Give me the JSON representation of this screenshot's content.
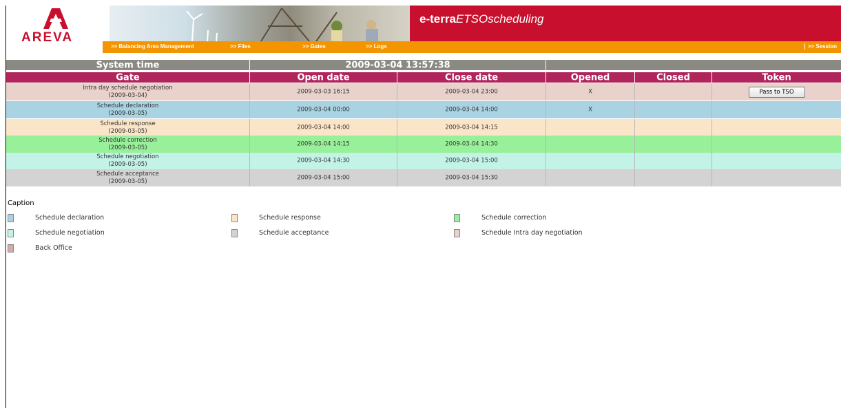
{
  "header": {
    "logo_text": "AREVA",
    "brand_prefix": "e-terra",
    "brand_suffix": "ETSOscheduling",
    "nav": {
      "balancing": ">> Balancing Area Management",
      "files": ">> Files",
      "gates": ">> Gates",
      "logs": ">> Logs",
      "session": ">> Session"
    }
  },
  "system": {
    "label": "System time",
    "value": "2009-03-04 13:57:38"
  },
  "table": {
    "columns": [
      "Gate",
      "Open date",
      "Close date",
      "Opened",
      "Closed",
      "Token"
    ],
    "rows": [
      {
        "gate": "Intra day schedule negotiation",
        "gate_date": "(2009-03-04)",
        "open": "2009-03-03 16:15",
        "close": "2009-03-04 23:00",
        "opened": "X",
        "closed": "",
        "token": "Pass to TSO"
      },
      {
        "gate": "Schedule declaration",
        "gate_date": "(2009-03-05)",
        "open": "2009-03-04 00:00",
        "close": "2009-03-04 14:00",
        "opened": "X",
        "closed": "",
        "token": ""
      },
      {
        "gate": "Schedule response",
        "gate_date": "(2009-03-05)",
        "open": "2009-03-04 14:00",
        "close": "2009-03-04 14:15",
        "opened": "",
        "closed": "",
        "token": ""
      },
      {
        "gate": "Schedule correction",
        "gate_date": "(2009-03-05)",
        "open": "2009-03-04 14:15",
        "close": "2009-03-04 14:30",
        "opened": "",
        "closed": "",
        "token": ""
      },
      {
        "gate": "Schedule negotiation",
        "gate_date": "(2009-03-05)",
        "open": "2009-03-04 14:30",
        "close": "2009-03-04 15:00",
        "opened": "",
        "closed": "",
        "token": ""
      },
      {
        "gate": "Schedule acceptance",
        "gate_date": "(2009-03-05)",
        "open": "2009-03-04 15:00",
        "close": "2009-03-04 15:30",
        "opened": "",
        "closed": "",
        "token": ""
      }
    ]
  },
  "caption": {
    "title": "Caption",
    "items": [
      {
        "label": "Schedule declaration",
        "color": "#a9d3e2"
      },
      {
        "label": "Schedule response",
        "color": "#fbe5c8"
      },
      {
        "label": "Schedule correction",
        "color": "#99f09a"
      },
      {
        "label": "Schedule negotiation",
        "color": "#c3f2e7"
      },
      {
        "label": "Schedule acceptance",
        "color": "#d3d3d3"
      },
      {
        "label": "Schedule Intra day negotiation",
        "color": "#ead2cc"
      },
      {
        "label": "Back Office",
        "color": "#d8aaa4"
      }
    ]
  },
  "colors": {
    "accent_red": "#c8102e",
    "nav_orange": "#f29500",
    "header_row": "#b0265c",
    "system_row": "#8a8a82"
  }
}
